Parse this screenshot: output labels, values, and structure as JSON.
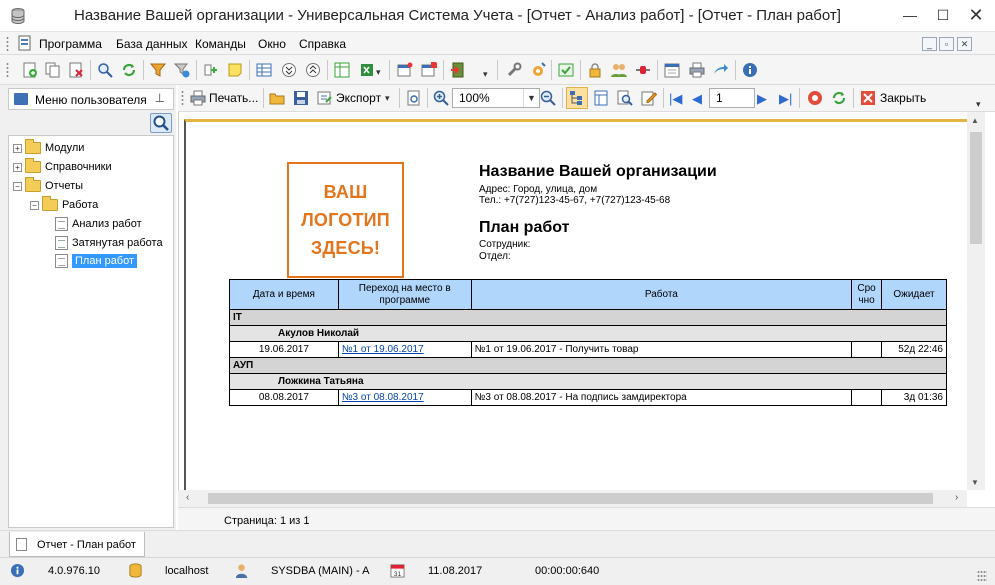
{
  "window": {
    "title": "Название Вашей организации - Универсальная Система Учета - [Отчет - Анализ работ] - [Отчет - План работ]"
  },
  "menu": {
    "items": [
      "Программа",
      "База данных",
      "Команды",
      "Окно",
      "Справка"
    ]
  },
  "left_panel": {
    "title": "Меню пользователя",
    "tree": [
      {
        "label": "Модули",
        "expander": "+"
      },
      {
        "label": "Справочники",
        "expander": "+"
      },
      {
        "label": "Отчеты",
        "expander": "−"
      },
      {
        "label": "Работа",
        "expander": "−"
      },
      {
        "label": "Анализ работ"
      },
      {
        "label": "Затянутая работа"
      },
      {
        "label": "План работ",
        "selected": true
      }
    ]
  },
  "viewer_toolbar": {
    "print_label": "Печать...",
    "export_label": "Экспорт",
    "zoom_value": "100%",
    "page_value": "1",
    "close_label": "Закрыть"
  },
  "report": {
    "logo_lines": [
      "ВАШ",
      "ЛОГОТИП",
      "ЗДЕСЬ!"
    ],
    "org_name": "Название Вашей организации",
    "address": "Адрес: Город, улица, дом",
    "phone": "Тел.: +7(727)123-45-67, +7(727)123-45-68",
    "plan_title": "План работ",
    "employee_label": "Сотрудник:",
    "department_label": "Отдел:",
    "columns": [
      "Дата и время",
      "Переход на место в программе",
      "Работа",
      "Сро чно",
      "Ожидает"
    ],
    "groups": [
      {
        "name": "IT",
        "person": "Акулов Николай",
        "row": {
          "date": "19.06.2017",
          "link": "№1 от 19.06.2017",
          "work": "№1 от 19.06.2017 - Получить товар",
          "urgent": "",
          "waiting": "52д 22:46"
        }
      },
      {
        "name": "АУП",
        "person": "Ложкина Татьяна",
        "row": {
          "date": "08.08.2017",
          "link": "№3 от 08.08.2017",
          "work": "№3 от 08.08.2017 - На подпись замдиректора",
          "urgent": "",
          "waiting": "3д 01:36"
        }
      }
    ]
  },
  "page_status": "Страница: 1 из 1",
  "mdi_tab": "Отчет - План работ",
  "status_bar": {
    "version": "4.0.976.10",
    "host": "localhost",
    "user": "SYSDBA (MAIN) - A",
    "date": "11.08.2017",
    "timer": "00:00:00:640"
  },
  "colors": {
    "selection": "#3399ff",
    "table_header": "#b1d6fb",
    "logo": "#e3751d"
  }
}
